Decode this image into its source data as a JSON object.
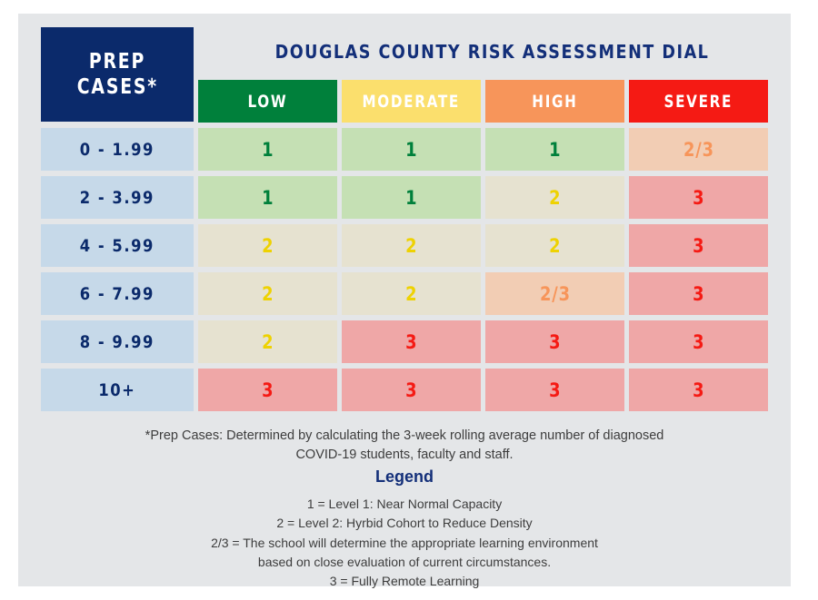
{
  "page": {
    "background": "#ffffff",
    "panel_background": "#e4e6e8"
  },
  "header": {
    "prep_label_line1": "PREP",
    "prep_label_line2": "CASES*",
    "prep_box_color": "#0b2a6b",
    "title": "DOUGLAS COUNTY RISK ASSESSMENT DIAL",
    "title_color": "#132f79"
  },
  "chart_data": {
    "type": "table",
    "title": "DOUGLAS COUNTY RISK ASSESSMENT DIAL",
    "row_header_label": "PREP CASES*",
    "categories": [
      {
        "label": "LOW",
        "bg": "#00803b",
        "text": "#ffffff"
      },
      {
        "label": "MODERATE",
        "bg": "#fbdf6d",
        "text": "#ffffff"
      },
      {
        "label": "HIGH",
        "bg": "#f7955a",
        "text": "#ffffff"
      },
      {
        "label": "SEVERE",
        "bg": "#f51a14",
        "text": "#ffffff"
      }
    ],
    "row_labels": [
      "0 - 1.99",
      "2 - 3.99",
      "4 - 5.99",
      "6 - 7.99",
      "8 - 9.99",
      "10+"
    ],
    "row_label_bg": "#c6d9e9",
    "row_label_text_color": "#0b2a6b",
    "level_styles": {
      "1": {
        "bg": "#c5e0b4",
        "fg": "#00803b"
      },
      "2": {
        "bg": "#e6e2d0",
        "fg": "#eed202"
      },
      "2/3": {
        "bg": "#f2cdb4",
        "fg": "#f7955a"
      },
      "3": {
        "bg": "#efa7a7",
        "fg": "#f51a14"
      }
    },
    "rows": [
      {
        "label": "0 - 1.99",
        "values": [
          "1",
          "1",
          "1",
          "2/3"
        ]
      },
      {
        "label": "2 - 3.99",
        "values": [
          "1",
          "1",
          "2",
          "3"
        ]
      },
      {
        "label": "4 - 5.99",
        "values": [
          "2",
          "2",
          "2",
          "3"
        ]
      },
      {
        "label": "6 - 7.99",
        "values": [
          "2",
          "2",
          "2/3",
          "3"
        ]
      },
      {
        "label": "8 - 9.99",
        "values": [
          "2",
          "3",
          "3",
          "3"
        ]
      },
      {
        "label": "10+",
        "values": [
          "3",
          "3",
          "3",
          "3"
        ]
      }
    ]
  },
  "footnote": {
    "line1": "*Prep Cases: Determined by calculating the  3-week rolling average number of diagnosed",
    "line2": "COVID-19 students, faculty and staff."
  },
  "legend": {
    "title": "Legend",
    "lines": [
      "1  = Level 1: Near Normal Capacity",
      "2  = Level 2: Hyrbid Cohort to Reduce Density",
      "2/3  = The school will determine the appropriate learning environment",
      "based on close evaluation of current circumstances.",
      "3  = Fully Remote Learning"
    ]
  }
}
